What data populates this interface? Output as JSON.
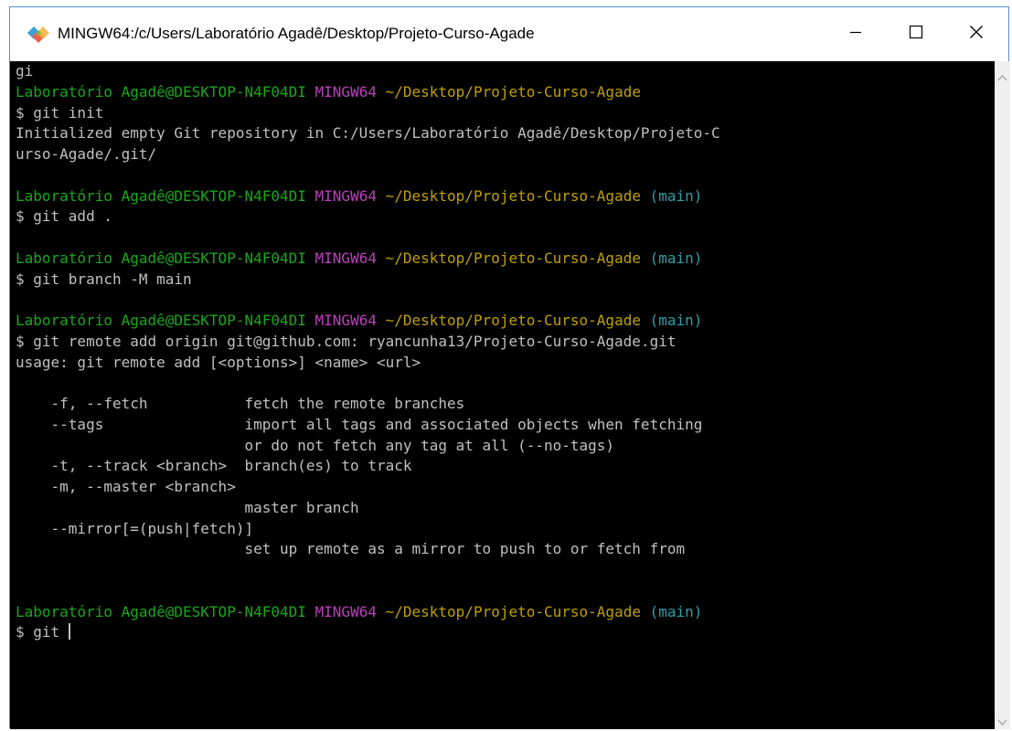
{
  "window": {
    "title": "MINGW64:/c/Users/Laboratório Agadê/Desktop/Projeto-Curso-Agade",
    "app_icon": "git-bash-icon",
    "controls": [
      "minimize-icon",
      "maximize-icon",
      "close-icon"
    ]
  },
  "terminal": {
    "colors": {
      "background": "#000000",
      "text": "#c0c0c0",
      "user": "#18a818",
      "host": "#bc3fbc",
      "path": "#c0a000",
      "branch": "#2a9fa8"
    },
    "prompt": {
      "user": "Laboratório Agadê@DESKTOP-N4F04DI",
      "host": "MINGW64",
      "path": "~/Desktop/Projeto-Curso-Agade",
      "branch": "(main)"
    },
    "lines": [
      {
        "type": "text",
        "text": "gi"
      },
      {
        "type": "prompt",
        "branch": false
      },
      {
        "type": "text",
        "text": "$ git init"
      },
      {
        "type": "text",
        "text": "Initialized empty Git repository in C:/Users/Laboratório Agadê/Desktop/Projeto-C"
      },
      {
        "type": "text",
        "text": "urso-Agade/.git/"
      },
      {
        "type": "text",
        "text": ""
      },
      {
        "type": "prompt",
        "branch": true
      },
      {
        "type": "text",
        "text": "$ git add ."
      },
      {
        "type": "text",
        "text": ""
      },
      {
        "type": "prompt",
        "branch": true
      },
      {
        "type": "text",
        "text": "$ git branch -M main"
      },
      {
        "type": "text",
        "text": ""
      },
      {
        "type": "prompt",
        "branch": true
      },
      {
        "type": "text",
        "text": "$ git remote add origin git@github.com: ryancunha13/Projeto-Curso-Agade.git"
      },
      {
        "type": "text",
        "text": "usage: git remote add [<options>] <name> <url>"
      },
      {
        "type": "text",
        "text": ""
      },
      {
        "type": "text",
        "text": "    -f, --fetch           fetch the remote branches"
      },
      {
        "type": "text",
        "text": "    --tags                import all tags and associated objects when fetching"
      },
      {
        "type": "text",
        "text": "                          or do not fetch any tag at all (--no-tags)"
      },
      {
        "type": "text",
        "text": "    -t, --track <branch>  branch(es) to track"
      },
      {
        "type": "text",
        "text": "    -m, --master <branch>"
      },
      {
        "type": "text",
        "text": "                          master branch"
      },
      {
        "type": "text",
        "text": "    --mirror[=(push|fetch)]"
      },
      {
        "type": "text",
        "text": "                          set up remote as a mirror to push to or fetch from"
      },
      {
        "type": "text",
        "text": ""
      },
      {
        "type": "text",
        "text": ""
      },
      {
        "type": "prompt",
        "branch": true
      },
      {
        "type": "input",
        "text": "$ git"
      }
    ]
  }
}
